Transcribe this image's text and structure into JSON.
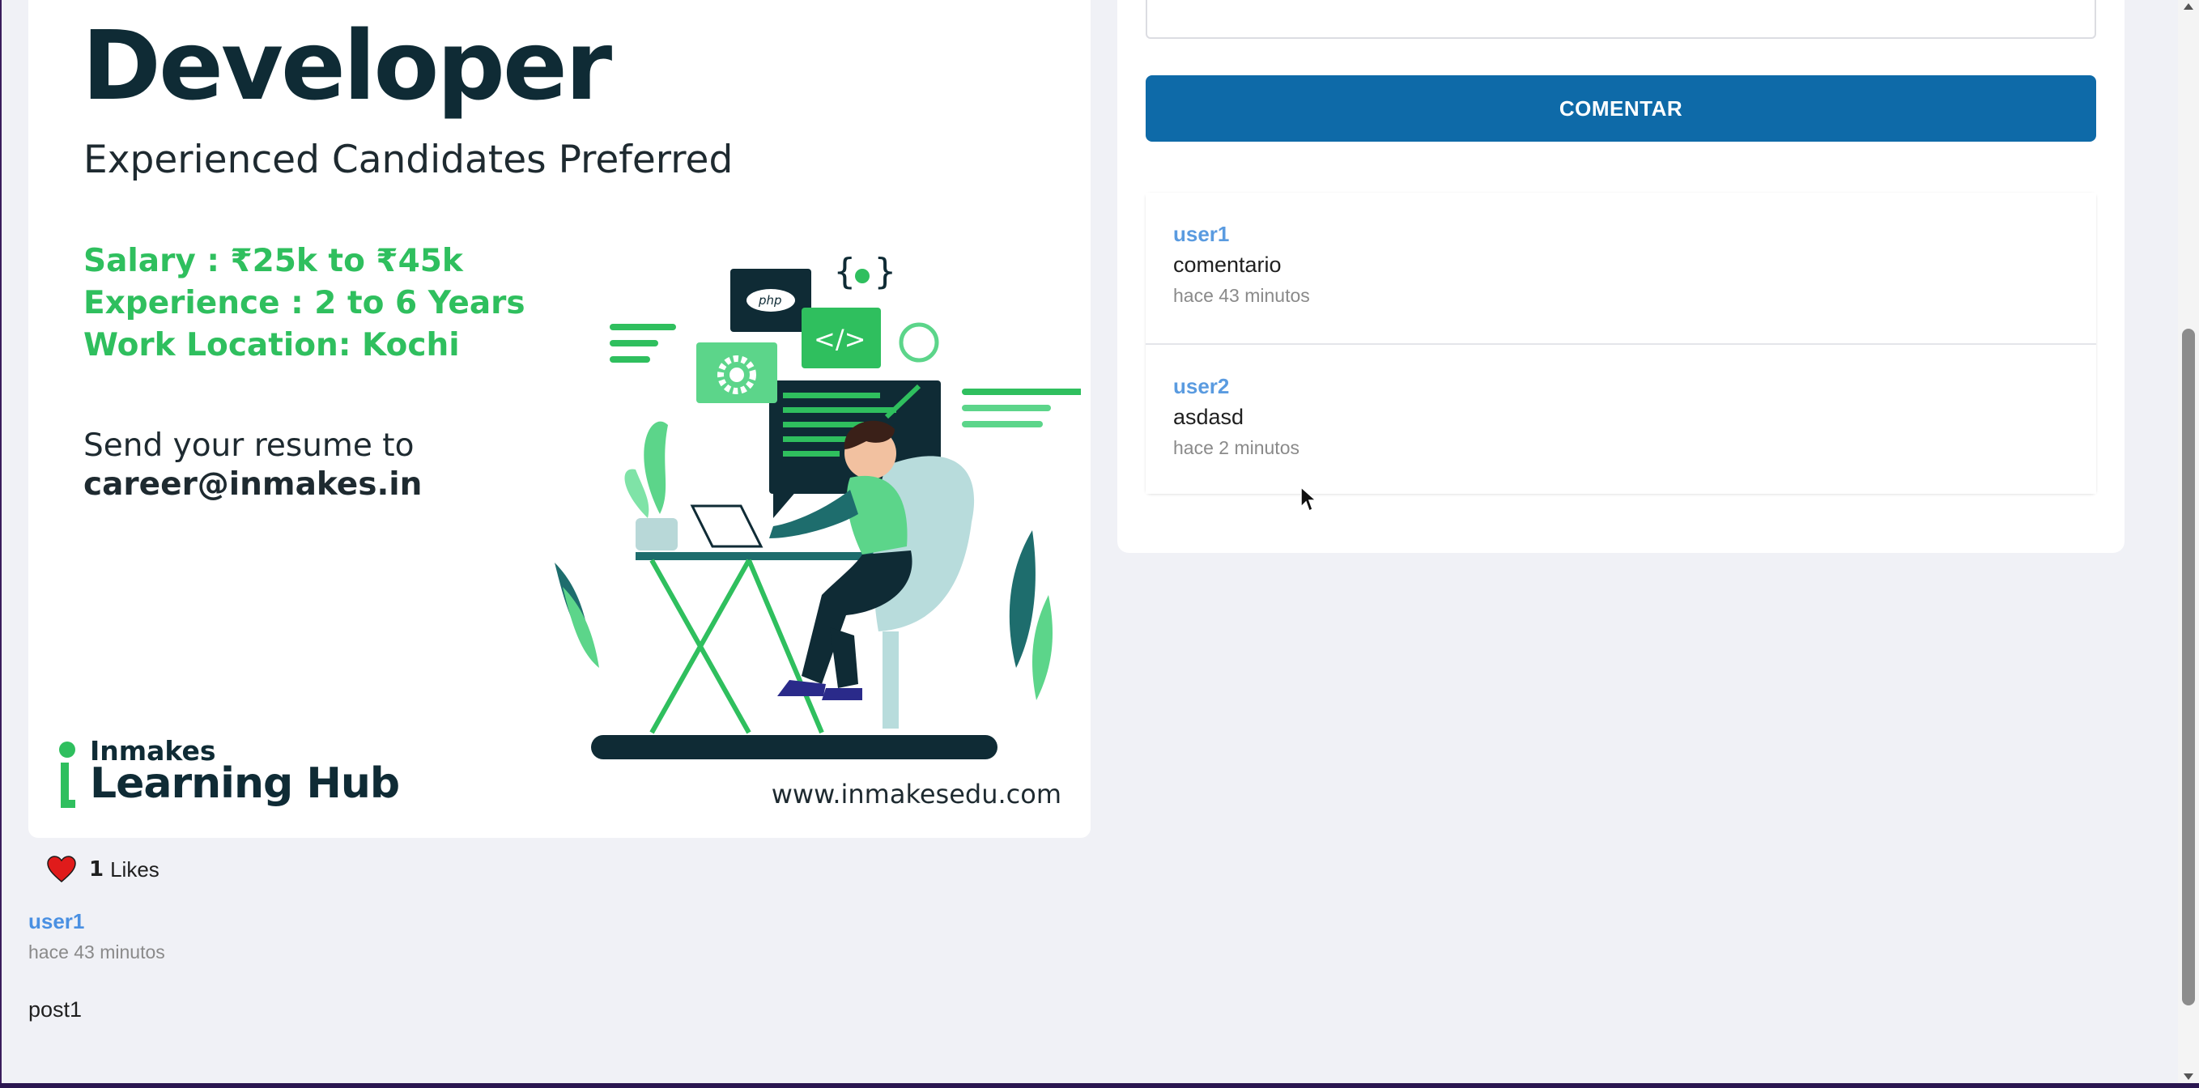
{
  "post": {
    "image": {
      "title": "Developer",
      "subtitle": "Experienced Candidates Preferred",
      "salary": "Salary : ₹25k to ₹45k",
      "experience": "Experience : 2 to 6 Years",
      "location": "Work Location: Kochi",
      "send_resume": "Send your resume to",
      "email": "career@inmakes.in",
      "logo_small": "Inmakes",
      "logo_big": "Learning Hub",
      "website": "www.inmakesedu.com",
      "php_badge": "php",
      "code_tag": "</>",
      "brand_green": "#2fbf5e",
      "brand_dark": "#0f2b35"
    },
    "likes": {
      "count": "1",
      "label": "Likes",
      "icon": "heart-icon",
      "color": "#e01b1b"
    },
    "author": "user1",
    "time": "hace 43 minutos",
    "text": "post1"
  },
  "comment_form": {
    "textarea_value": "",
    "button_label": "COMENTAR",
    "button_color": "#0e6aa8"
  },
  "comments": [
    {
      "user": "user1",
      "text": "comentario",
      "time": "hace 43 minutos"
    },
    {
      "user": "user2",
      "text": "asdasd",
      "time": "hace 2 minutos"
    }
  ],
  "colors": {
    "background": "#f0f1f6",
    "link_blue": "#4a90e2",
    "muted_text": "#8a8a8a"
  }
}
